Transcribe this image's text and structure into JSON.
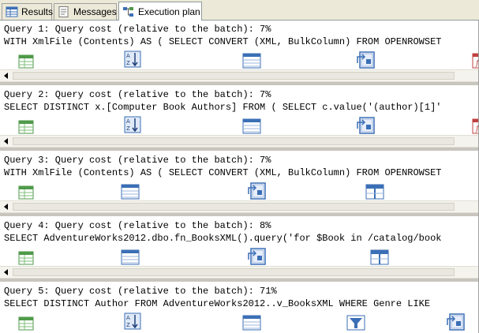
{
  "tabs": [
    {
      "label": "Results",
      "icon": "grid-icon"
    },
    {
      "label": "Messages",
      "icon": "messages-icon"
    },
    {
      "label": "Execution plan",
      "icon": "execution-plan-icon",
      "active": true
    }
  ],
  "queries": [
    {
      "cost_line": "Query 1: Query cost (relative to the batch): 7%",
      "sql": "WITH XmlFile (Contents) AS ( SELECT CONVERT (XML, BulkColumn) FROM OPENROWSET",
      "operators": [
        "select-icon",
        "sort-icon",
        "compute-scalar-icon",
        "nested-loops-icon",
        "table-valued-function-icon"
      ]
    },
    {
      "cost_line": "Query 2: Query cost (relative to the batch): 7%",
      "sql": "SELECT DISTINCT x.[Computer Book Authors] FROM ( SELECT c.value('(author)[1]'",
      "operators": [
        "select-icon",
        "sort-icon",
        "compute-scalar-icon",
        "nested-loops-icon",
        "table-valued-function-icon"
      ]
    },
    {
      "cost_line": "Query 3: Query cost (relative to the batch): 7%",
      "sql": "WITH XmlFile (Contents) AS ( SELECT CONVERT (XML, BulkColumn) FROM OPENROWSET",
      "operators": [
        "select-icon",
        "compute-scalar-icon",
        "nested-loops-icon",
        "stream-aggregate-icon"
      ]
    },
    {
      "cost_line": "Query 4: Query cost (relative to the batch): 8%",
      "sql": "SELECT AdventureWorks2012.dbo.fn_BooksXML().query('for $Book in /catalog/book",
      "operators": [
        "select-icon",
        "compute-scalar-icon",
        "nested-loops-icon",
        "stream-aggregate-icon"
      ]
    },
    {
      "cost_line": "Query 5: Query cost (relative to the batch): 71%",
      "sql": "SELECT DISTINCT Author FROM AdventureWorks2012..v_BooksXML WHERE Genre LIKE",
      "operators": [
        "select-icon",
        "sort-icon",
        "compute-scalar-icon",
        "filter-icon",
        "nested-loops-icon"
      ]
    }
  ],
  "colors": {
    "tab_bg": "#ece9d8",
    "icon_blue": "#3b6fb6",
    "icon_green": "#4f9a4a",
    "separator": "#c7c5bd"
  }
}
